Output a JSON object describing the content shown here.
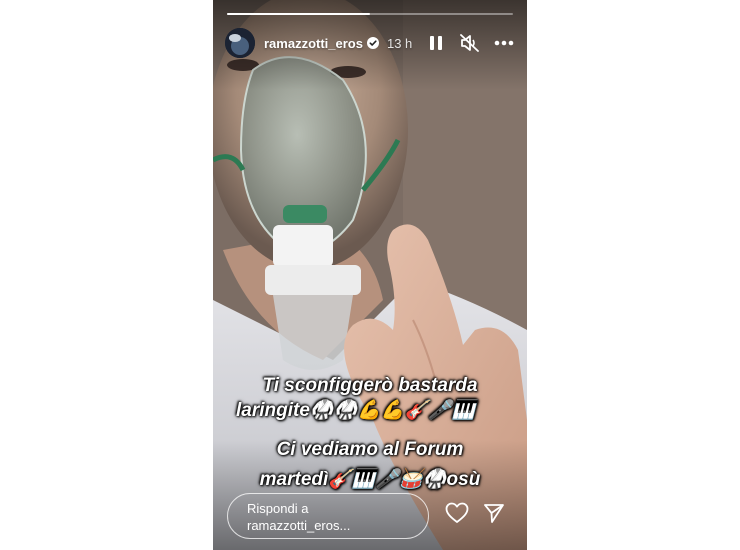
{
  "story": {
    "progress_fraction": 0.5,
    "username": "ramazzotti_eros",
    "time": "13 h",
    "caption": {
      "line1": "Ti sconfiggerò bastarda",
      "line2": "laringite🥋🥋💪💪🎸🎤🎹",
      "line3": "Ci vediamo al Forum",
      "line4": "martedì🎸🎹🎤🥁🥋osù"
    },
    "reply": {
      "line1": "Rispondi a",
      "line2": "ramazzotti_eros..."
    }
  }
}
